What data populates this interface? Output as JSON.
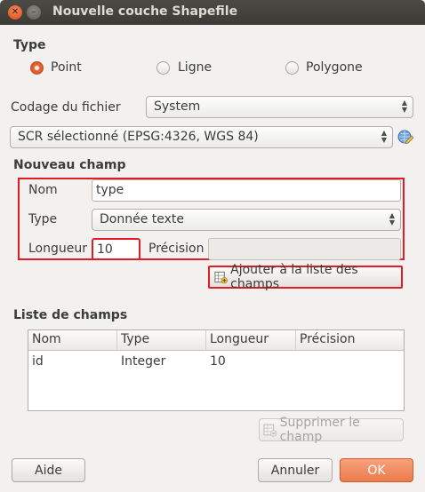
{
  "window": {
    "title": "Nouvelle couche Shapefile",
    "close_glyph": "✕",
    "minimize_glyph": "–"
  },
  "type_section": {
    "title": "Type",
    "options": [
      {
        "label": "Point",
        "checked": true
      },
      {
        "label": "Ligne",
        "checked": false
      },
      {
        "label": "Polygone",
        "checked": false
      }
    ]
  },
  "encoding": {
    "label": "Codage du fichier",
    "value": "System"
  },
  "crs": {
    "value": "SCR sélectionné (EPSG:4326, WGS 84)",
    "picker_icon": "globe-pencil-icon"
  },
  "new_field": {
    "title": "Nouveau champ",
    "name_label": "Nom",
    "name_value": "type",
    "type_label": "Type",
    "type_value": "Donnée texte",
    "length_label": "Longueur",
    "length_value": "10",
    "precision_label": "Précision",
    "precision_value": "",
    "add_button": "Ajouter à la liste des champs"
  },
  "field_list": {
    "title": "Liste de champs",
    "columns": [
      "Nom",
      "Type",
      "Longueur",
      "Précision"
    ],
    "rows": [
      {
        "nom": "id",
        "type": "Integer",
        "longueur": "10",
        "precision": ""
      }
    ],
    "delete_button": "Supprimer le champ"
  },
  "footer": {
    "help": "Aide",
    "cancel": "Annuler",
    "ok": "OK"
  },
  "colors": {
    "accent": "#e86a3c",
    "highlight_box": "#e31b23",
    "titlebar": "#3c3b37"
  }
}
